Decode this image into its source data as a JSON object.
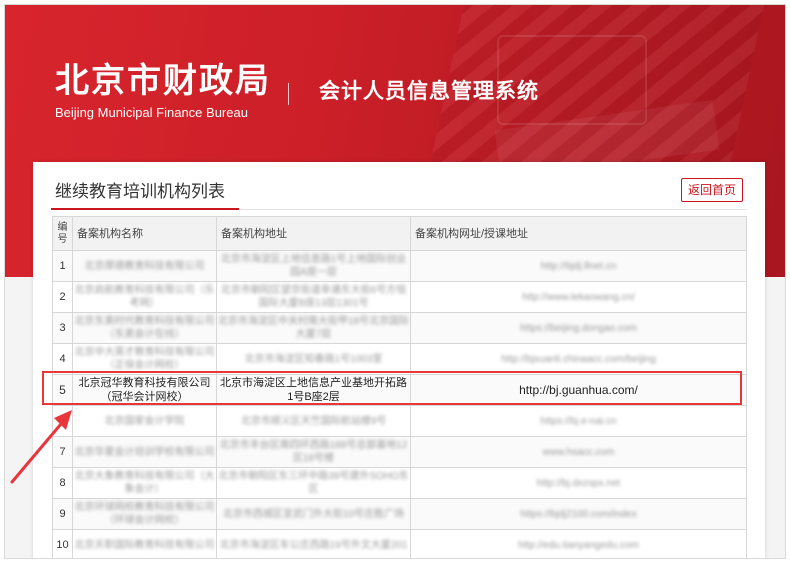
{
  "header": {
    "org_name_cn": "北京市财政局",
    "org_name_en": "Beijing Municipal Finance Bureau",
    "system_title": "会计人员信息管理系统"
  },
  "panel": {
    "title": "继续教育培训机构列表",
    "back_button": "返回首页"
  },
  "table": {
    "columns": [
      "编号",
      "备案机构名称",
      "备案机构地址",
      "备案机构网址/授课地址"
    ],
    "rows": [
      {
        "num": "1",
        "name": "北京厚德教育科技有限公司",
        "address": "北京市海淀区上地信息路1号上地国际创业园A座一层",
        "url": "http://bjdj.lfnet.cn"
      },
      {
        "num": "2",
        "name": "北京启航教育科技有限公司（乐考网）",
        "address": "北京市朝阳区望京街道阜通东大街6号方恒国际大厦B座13层1301号",
        "url": "http://www.lekaowang.cn/"
      },
      {
        "num": "3",
        "name": "北京东奥时代教育科技有限公司（东奥会计在线）",
        "address": "北京市海淀区中关村南大街甲18号北京国际大厦7层",
        "url": "https://beijing.dongao.com"
      },
      {
        "num": "4",
        "name": "北京中大英才教育科技有限公司（正保会计网校）",
        "address": "北京市海淀区知春路1号1003室",
        "url": "http://bjxuanli.chinaacc.com/beijing"
      },
      {
        "num": "5",
        "name": "北京冠华教育科技有限公司（冠华会计网校）",
        "address": "北京市海淀区上地信息产业基地开拓路1号B座2层",
        "url": "http://bj.guanhua.com/"
      },
      {
        "num": "6",
        "name": "北京国家会计学院",
        "address": "北京市顺义区天竺国际航站楼9号",
        "url": "https://bj.e-nai.cn"
      },
      {
        "num": "7",
        "name": "北京华夏会计培训学校有限公司",
        "address": "北京市丰台区南四环西路188号总部基地12区18号楼",
        "url": "www.hsacc.com"
      },
      {
        "num": "8",
        "name": "北京大象教育科技有限公司（大象会计）",
        "address": "北京市朝阳区东三环中路39号建外SOHO东区",
        "url": "http://bj.dxzspx.net"
      },
      {
        "num": "9",
        "name": "北京环球网校教育科技有限公司（环球会计网校）",
        "address": "北京市西城区宣武门外大街10号庄胜广场",
        "url": "https://bjdj2100.com/index"
      },
      {
        "num": "10",
        "name": "北京天职国际教育科技有限公司",
        "address": "北京市海淀区车公庄西路19号外文大厦201",
        "url": "http://edu.tianyangedu.com"
      }
    ]
  },
  "annotation": {
    "highlight_color": "#e8363d",
    "arrow_color": "#e8363d"
  },
  "colors": {
    "brand_red": "#c9151e",
    "banner_red": "#d8252d"
  }
}
